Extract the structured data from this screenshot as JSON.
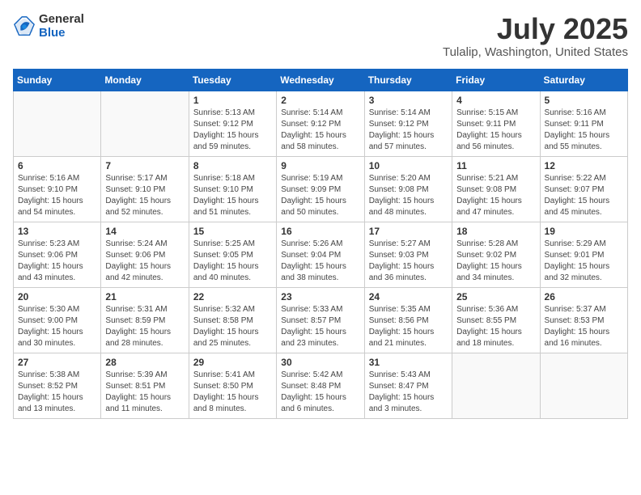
{
  "logo": {
    "general": "General",
    "blue": "Blue"
  },
  "title": "July 2025",
  "subtitle": "Tulalip, Washington, United States",
  "weekdays": [
    "Sunday",
    "Monday",
    "Tuesday",
    "Wednesday",
    "Thursday",
    "Friday",
    "Saturday"
  ],
  "weeks": [
    [
      {
        "day": "",
        "info": ""
      },
      {
        "day": "",
        "info": ""
      },
      {
        "day": "1",
        "info": "Sunrise: 5:13 AM\nSunset: 9:12 PM\nDaylight: 15 hours and 59 minutes."
      },
      {
        "day": "2",
        "info": "Sunrise: 5:14 AM\nSunset: 9:12 PM\nDaylight: 15 hours and 58 minutes."
      },
      {
        "day": "3",
        "info": "Sunrise: 5:14 AM\nSunset: 9:12 PM\nDaylight: 15 hours and 57 minutes."
      },
      {
        "day": "4",
        "info": "Sunrise: 5:15 AM\nSunset: 9:11 PM\nDaylight: 15 hours and 56 minutes."
      },
      {
        "day": "5",
        "info": "Sunrise: 5:16 AM\nSunset: 9:11 PM\nDaylight: 15 hours and 55 minutes."
      }
    ],
    [
      {
        "day": "6",
        "info": "Sunrise: 5:16 AM\nSunset: 9:10 PM\nDaylight: 15 hours and 54 minutes."
      },
      {
        "day": "7",
        "info": "Sunrise: 5:17 AM\nSunset: 9:10 PM\nDaylight: 15 hours and 52 minutes."
      },
      {
        "day": "8",
        "info": "Sunrise: 5:18 AM\nSunset: 9:10 PM\nDaylight: 15 hours and 51 minutes."
      },
      {
        "day": "9",
        "info": "Sunrise: 5:19 AM\nSunset: 9:09 PM\nDaylight: 15 hours and 50 minutes."
      },
      {
        "day": "10",
        "info": "Sunrise: 5:20 AM\nSunset: 9:08 PM\nDaylight: 15 hours and 48 minutes."
      },
      {
        "day": "11",
        "info": "Sunrise: 5:21 AM\nSunset: 9:08 PM\nDaylight: 15 hours and 47 minutes."
      },
      {
        "day": "12",
        "info": "Sunrise: 5:22 AM\nSunset: 9:07 PM\nDaylight: 15 hours and 45 minutes."
      }
    ],
    [
      {
        "day": "13",
        "info": "Sunrise: 5:23 AM\nSunset: 9:06 PM\nDaylight: 15 hours and 43 minutes."
      },
      {
        "day": "14",
        "info": "Sunrise: 5:24 AM\nSunset: 9:06 PM\nDaylight: 15 hours and 42 minutes."
      },
      {
        "day": "15",
        "info": "Sunrise: 5:25 AM\nSunset: 9:05 PM\nDaylight: 15 hours and 40 minutes."
      },
      {
        "day": "16",
        "info": "Sunrise: 5:26 AM\nSunset: 9:04 PM\nDaylight: 15 hours and 38 minutes."
      },
      {
        "day": "17",
        "info": "Sunrise: 5:27 AM\nSunset: 9:03 PM\nDaylight: 15 hours and 36 minutes."
      },
      {
        "day": "18",
        "info": "Sunrise: 5:28 AM\nSunset: 9:02 PM\nDaylight: 15 hours and 34 minutes."
      },
      {
        "day": "19",
        "info": "Sunrise: 5:29 AM\nSunset: 9:01 PM\nDaylight: 15 hours and 32 minutes."
      }
    ],
    [
      {
        "day": "20",
        "info": "Sunrise: 5:30 AM\nSunset: 9:00 PM\nDaylight: 15 hours and 30 minutes."
      },
      {
        "day": "21",
        "info": "Sunrise: 5:31 AM\nSunset: 8:59 PM\nDaylight: 15 hours and 28 minutes."
      },
      {
        "day": "22",
        "info": "Sunrise: 5:32 AM\nSunset: 8:58 PM\nDaylight: 15 hours and 25 minutes."
      },
      {
        "day": "23",
        "info": "Sunrise: 5:33 AM\nSunset: 8:57 PM\nDaylight: 15 hours and 23 minutes."
      },
      {
        "day": "24",
        "info": "Sunrise: 5:35 AM\nSunset: 8:56 PM\nDaylight: 15 hours and 21 minutes."
      },
      {
        "day": "25",
        "info": "Sunrise: 5:36 AM\nSunset: 8:55 PM\nDaylight: 15 hours and 18 minutes."
      },
      {
        "day": "26",
        "info": "Sunrise: 5:37 AM\nSunset: 8:53 PM\nDaylight: 15 hours and 16 minutes."
      }
    ],
    [
      {
        "day": "27",
        "info": "Sunrise: 5:38 AM\nSunset: 8:52 PM\nDaylight: 15 hours and 13 minutes."
      },
      {
        "day": "28",
        "info": "Sunrise: 5:39 AM\nSunset: 8:51 PM\nDaylight: 15 hours and 11 minutes."
      },
      {
        "day": "29",
        "info": "Sunrise: 5:41 AM\nSunset: 8:50 PM\nDaylight: 15 hours and 8 minutes."
      },
      {
        "day": "30",
        "info": "Sunrise: 5:42 AM\nSunset: 8:48 PM\nDaylight: 15 hours and 6 minutes."
      },
      {
        "day": "31",
        "info": "Sunrise: 5:43 AM\nSunset: 8:47 PM\nDaylight: 15 hours and 3 minutes."
      },
      {
        "day": "",
        "info": ""
      },
      {
        "day": "",
        "info": ""
      }
    ]
  ]
}
